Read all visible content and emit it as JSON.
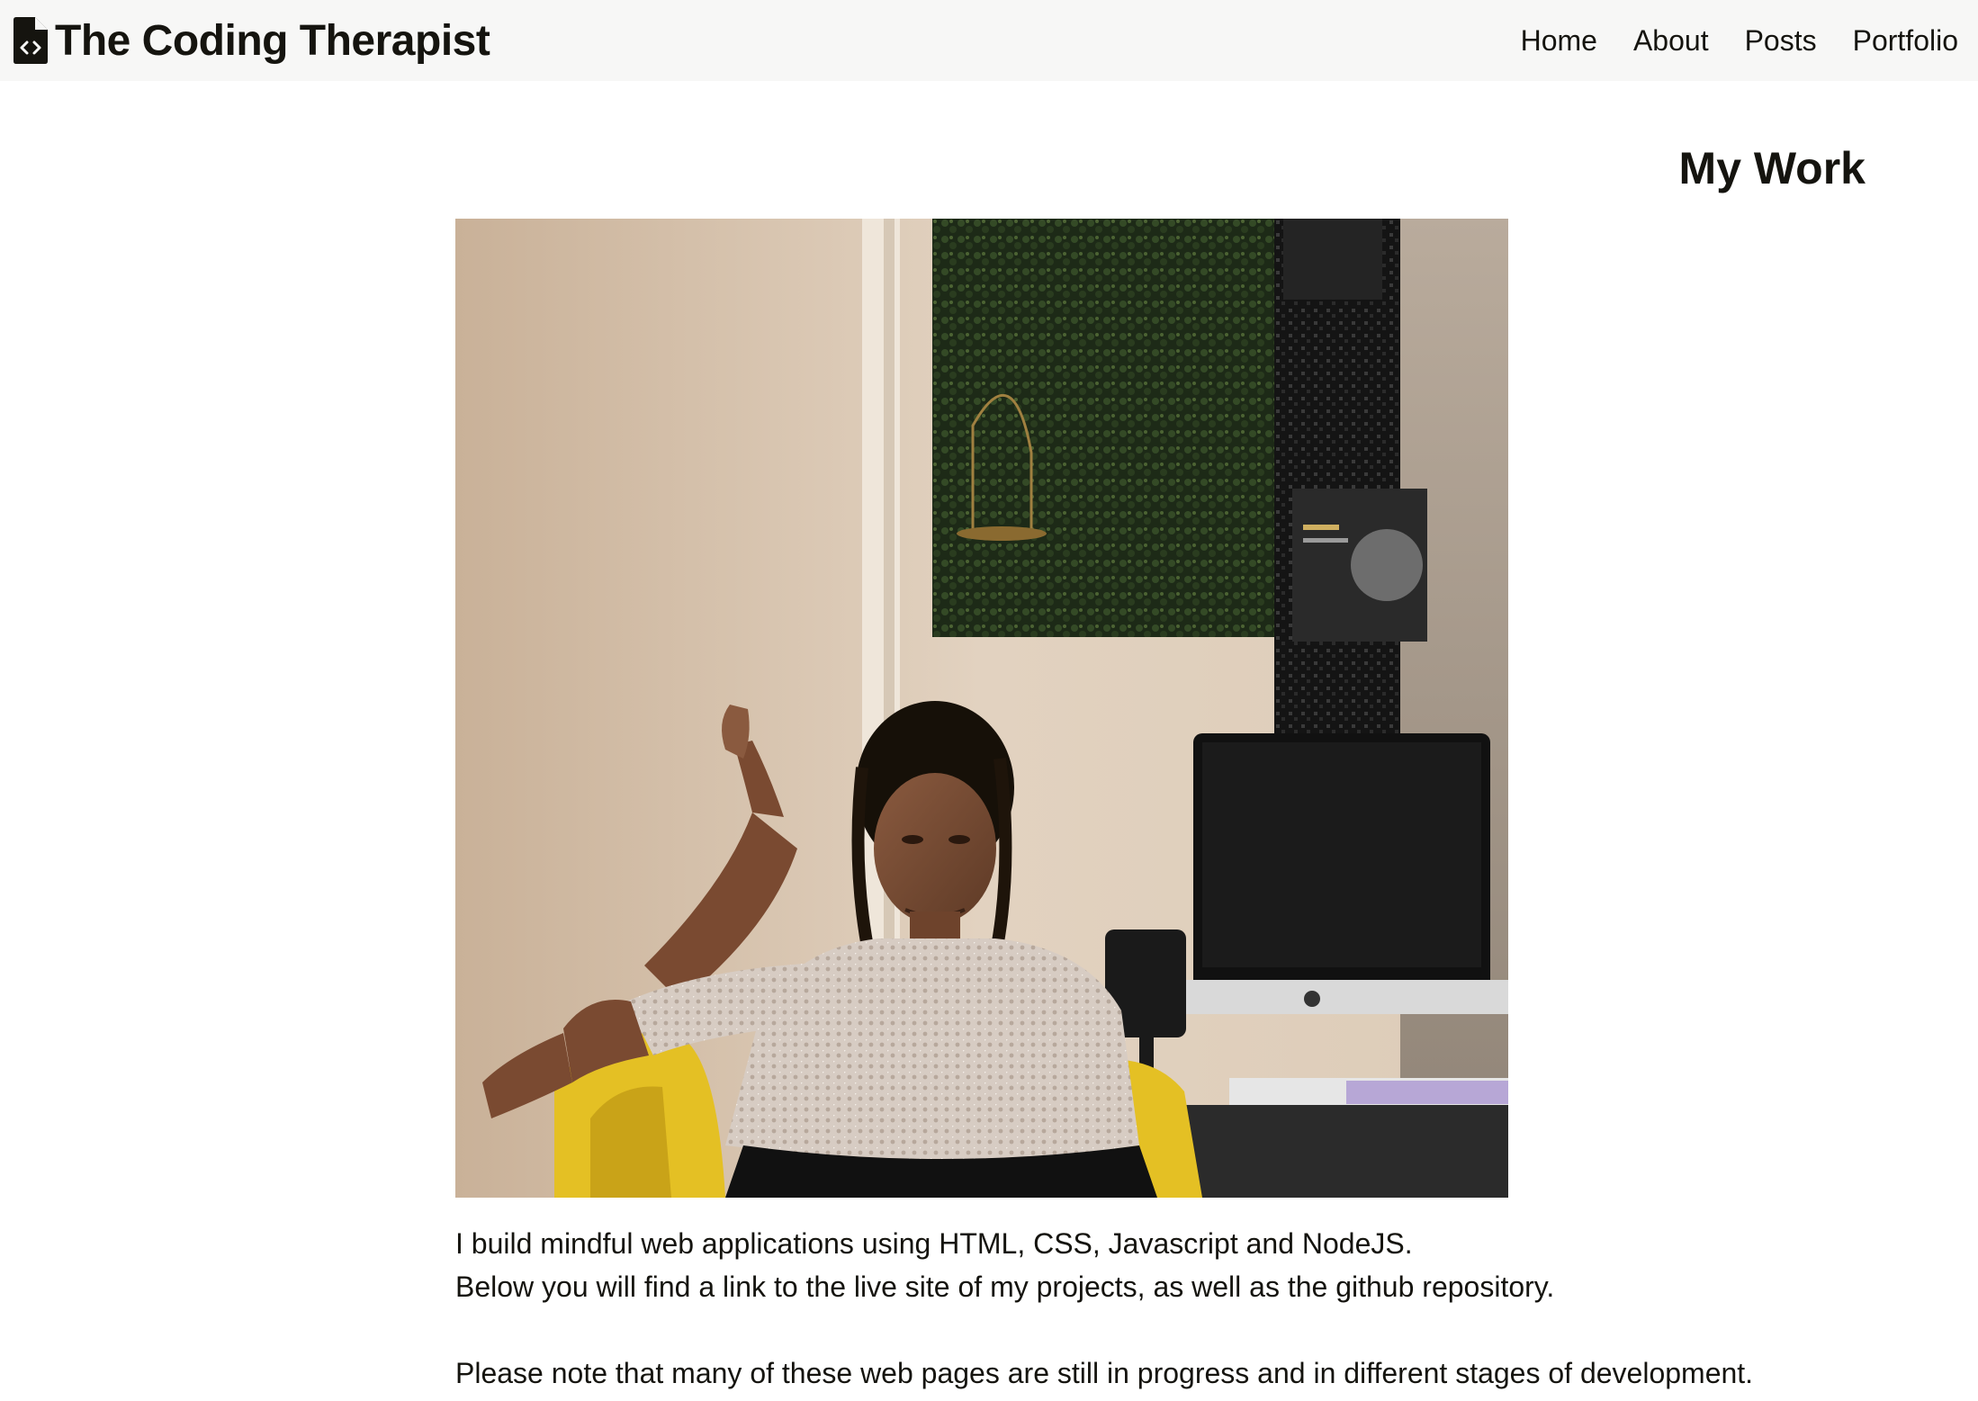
{
  "header": {
    "brand": "The Coding Therapist",
    "brand_icon": "file-code-icon",
    "nav": [
      {
        "label": "Home"
      },
      {
        "label": "About"
      },
      {
        "label": "Posts"
      },
      {
        "label": "Portfolio"
      }
    ]
  },
  "main": {
    "title": "My Work",
    "intro_lines": [
      "I build mindful web applications using HTML, CSS, Javascript and NodeJS.",
      "Below you will find a link to the live site of my projects, as well as the github repository.",
      "Please note that many of these web pages are still in progress and in different stages of development."
    ]
  },
  "colors": {
    "text": "#15140f",
    "navbar_bg": "#f7f7f6",
    "page_bg": "#ffffff"
  }
}
